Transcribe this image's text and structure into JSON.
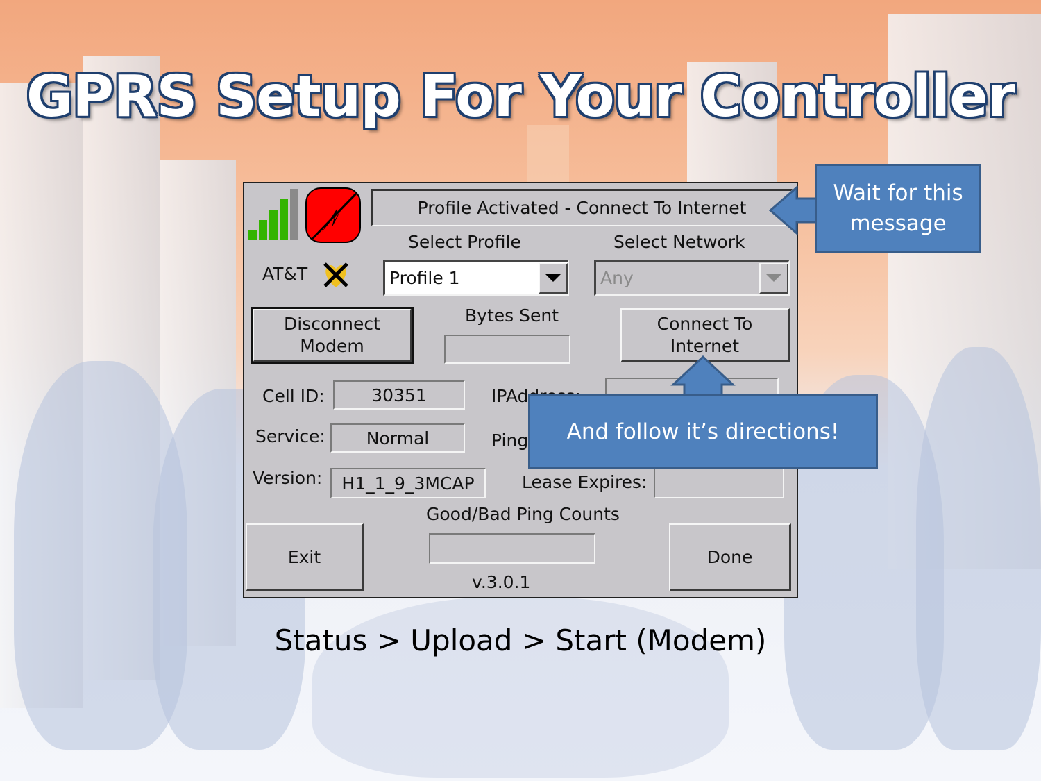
{
  "slide": {
    "title": "GPRS Setup For Your Controller",
    "footer_path": "Status > Upload > Start (Modem)"
  },
  "screen": {
    "status_message": "Profile Activated - Connect To Internet",
    "signal_icon": "signal-strength-icon",
    "signal_bars_active": 4,
    "signal_bars_total": 5,
    "connection_icon": "connection-status-icon",
    "carrier_label": "AT&T",
    "carrier_status_icon": "roaming-x-icon",
    "select_profile_label": "Select Profile",
    "profile_value": "Profile 1",
    "select_network_label": "Select Network",
    "network_value": "Any",
    "disconnect_button": "Disconnect\nModem",
    "bytes_sent_label": "Bytes Sent",
    "bytes_sent_value": "",
    "connect_button": "Connect To\nInternet",
    "cell_id_label": "Cell ID:",
    "cell_id_value": "30351",
    "ip_address_label": "IPAddress:",
    "ip_address_value": "",
    "service_label": "Service:",
    "service_value": "Normal",
    "ping_label": "Ping",
    "version_label": "Version:",
    "version_value": "H1_1_9_3MCAP",
    "lease_label": "Lease Expires:",
    "lease_value": "",
    "ping_counts_label": "Good/Bad Ping Counts",
    "ping_counts_value": "",
    "exit_button": "Exit",
    "done_button": "Done",
    "app_version": "v.3.0.1"
  },
  "callouts": {
    "wait_message": "Wait for this message",
    "follow_directions": "And follow it’s directions!"
  },
  "colors": {
    "callout_fill": "#4f81bd",
    "callout_border": "#385d8a",
    "screen_bg": "#c8c6ca",
    "signal_green": "#33b400",
    "connection_red": "#ff0000",
    "title_outline": "#1f3f6e"
  }
}
